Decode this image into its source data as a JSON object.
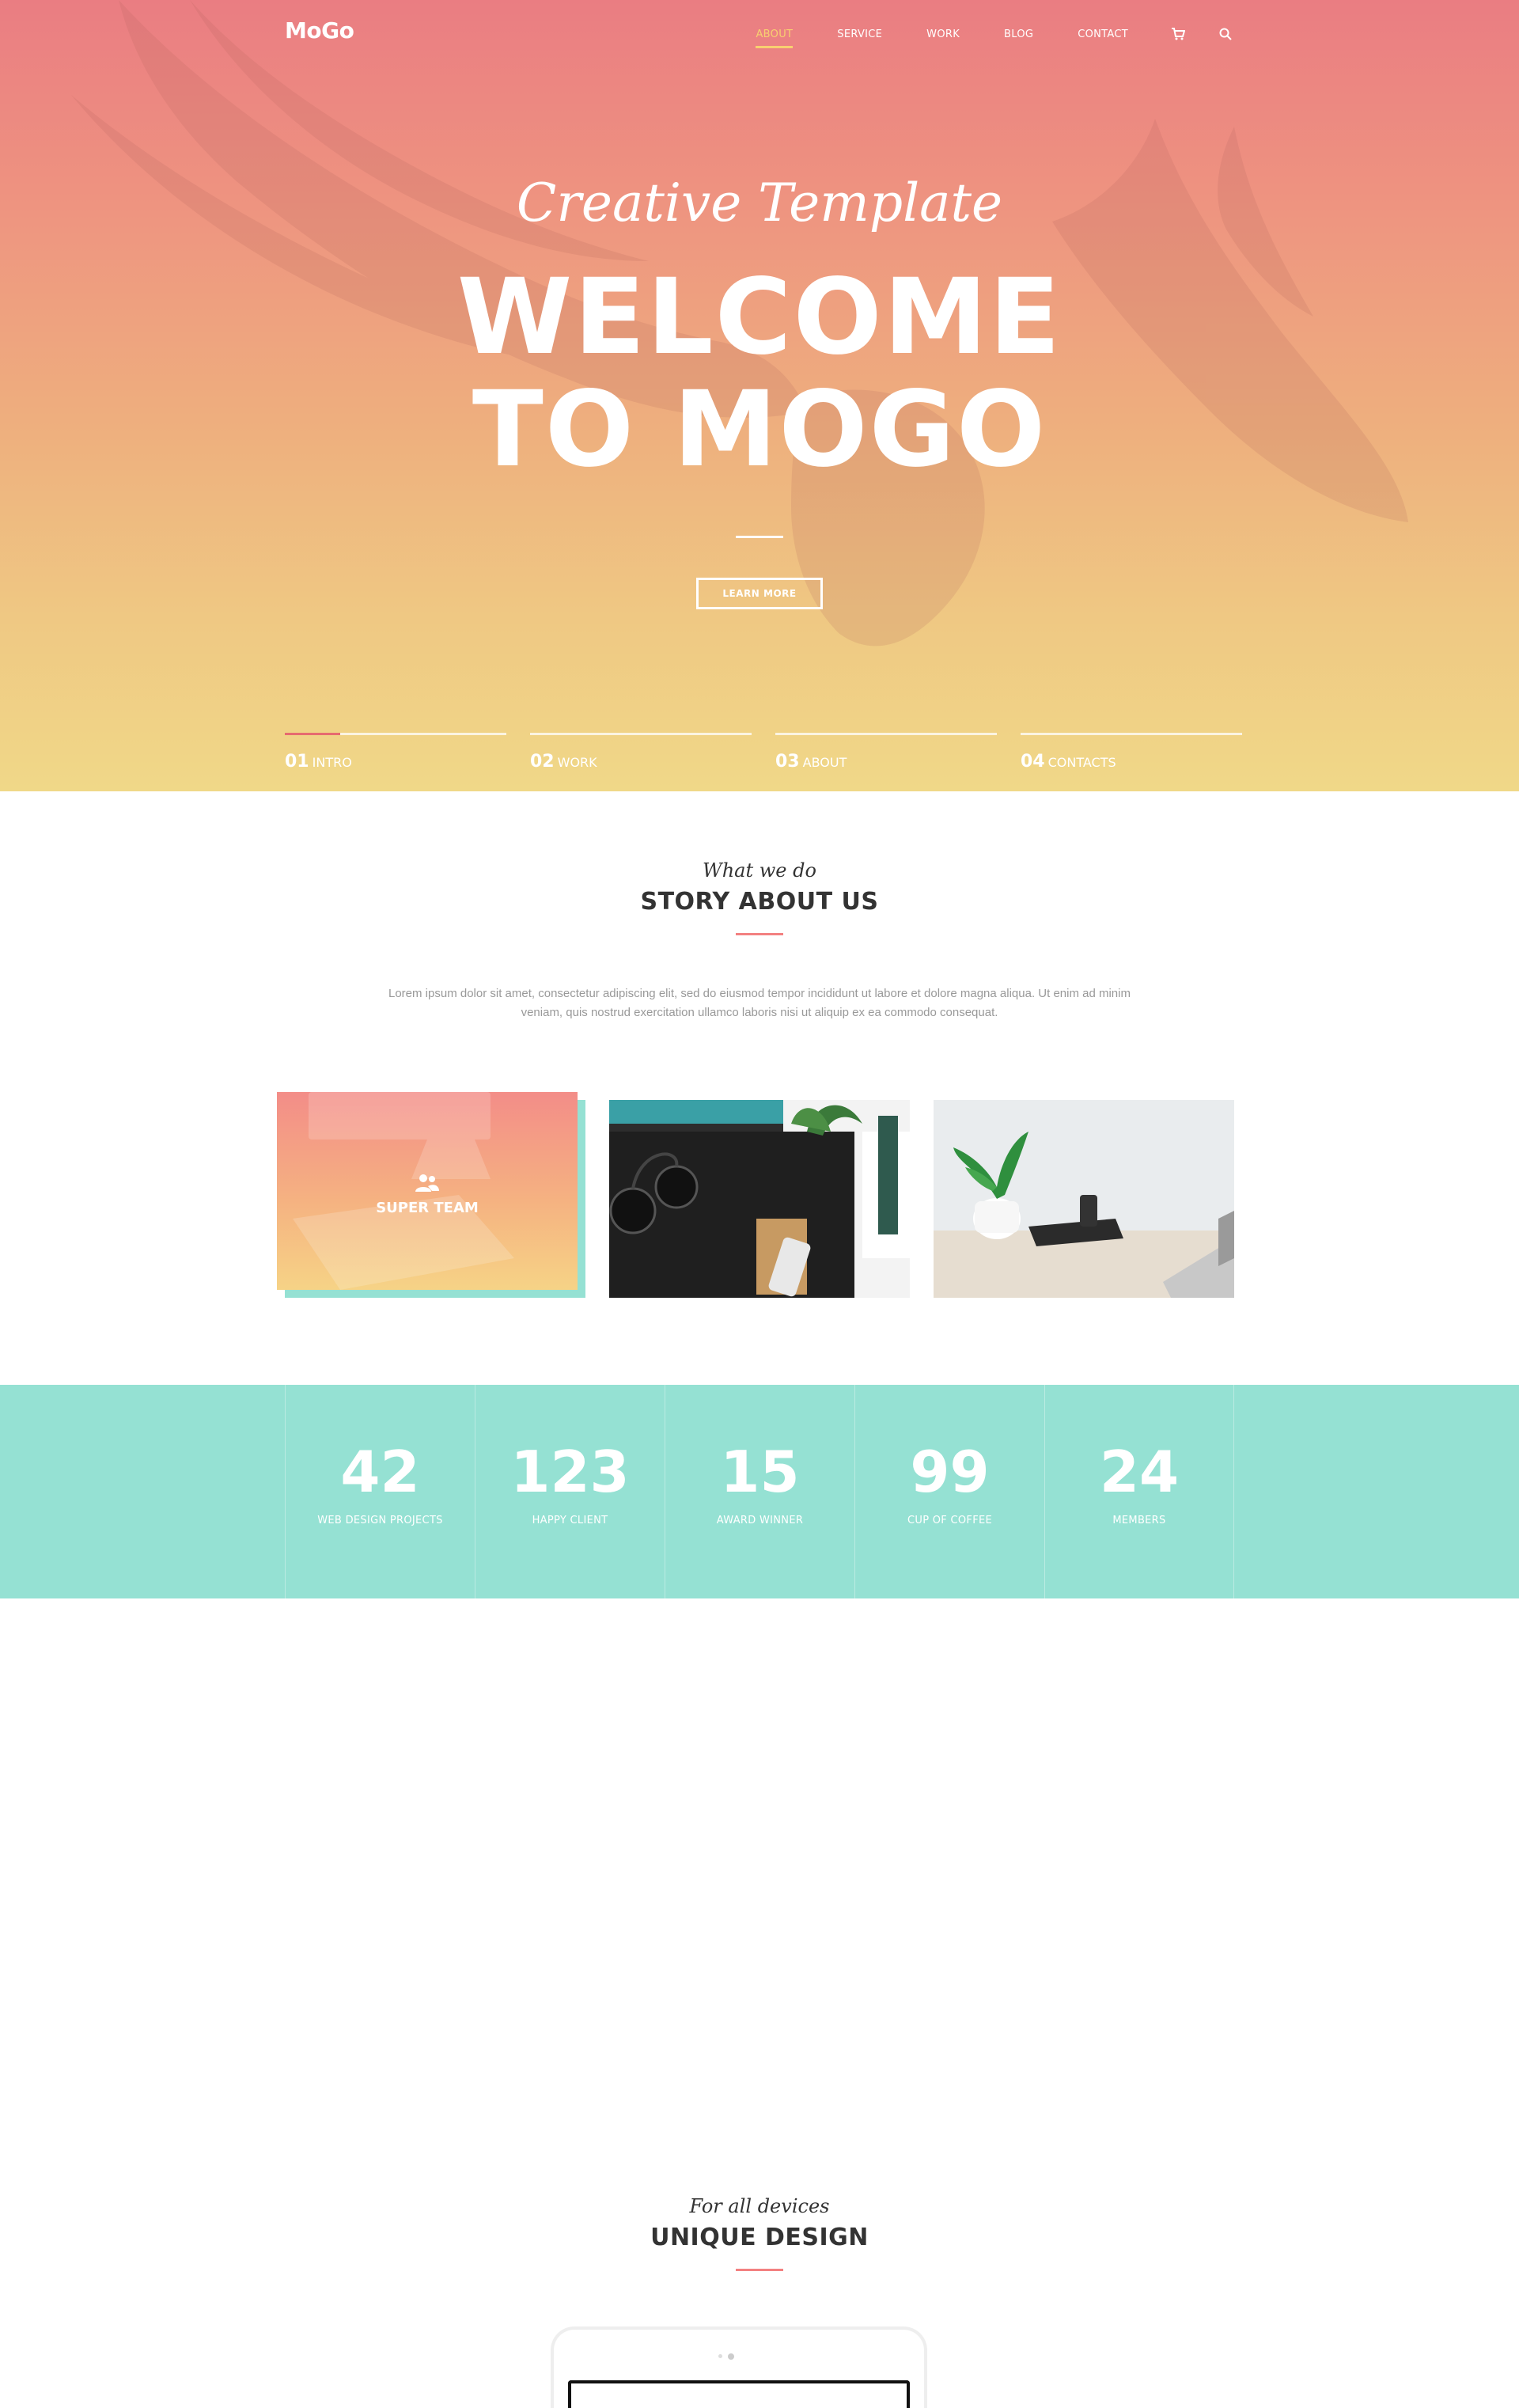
{
  "header": {
    "logo": "MoGo",
    "nav": [
      {
        "label": "ABOUT",
        "active": true
      },
      {
        "label": "SERVICE",
        "active": false
      },
      {
        "label": "WORK",
        "active": false
      },
      {
        "label": "BLOG",
        "active": false
      },
      {
        "label": "CONTACT",
        "active": false
      }
    ],
    "icons": [
      "cart-icon",
      "search-icon"
    ]
  },
  "hero": {
    "subtitle": "Creative Template",
    "title_line1": "WELCOME",
    "title_line2": "TO MOGO",
    "button": "LEARN MORE",
    "slides": [
      {
        "num": "01",
        "label": "INTRO",
        "progress": 0.25
      },
      {
        "num": "02",
        "label": "WORK",
        "progress": 0
      },
      {
        "num": "03",
        "label": "ABOUT",
        "progress": 0
      },
      {
        "num": "04",
        "label": "CONTACTS",
        "progress": 0
      }
    ]
  },
  "about": {
    "kicker": "What we do",
    "title": "STORY ABOUT US",
    "text": "Lorem ipsum dolor sit amet, consectetur adipiscing elit, sed do eiusmod tempor incididunt ut labore et dolore magna aliqua. Ut enim ad minim veniam, quis nostrud exercitation ullamco laboris nisi ut aliquip ex ea commodo consequat.",
    "cards": [
      {
        "label": "SUPER TEAM",
        "icon": "users-icon"
      }
    ]
  },
  "stats": [
    {
      "value": "42",
      "label": "WEB DESIGN PROJECTS"
    },
    {
      "value": "123",
      "label": "HAPPY CLIENT"
    },
    {
      "value": "15",
      "label": "AWARD WINNER"
    },
    {
      "value": "99",
      "label": "CUP OF COFFEE"
    },
    {
      "value": "24",
      "label": "MEMBERS"
    }
  ],
  "design": {
    "kicker": "For all devices",
    "title": "UNIQUE DESIGN"
  },
  "colors": {
    "accent": "#f38181",
    "nav_active": "#f8d070",
    "teal": "#95e1d3"
  }
}
